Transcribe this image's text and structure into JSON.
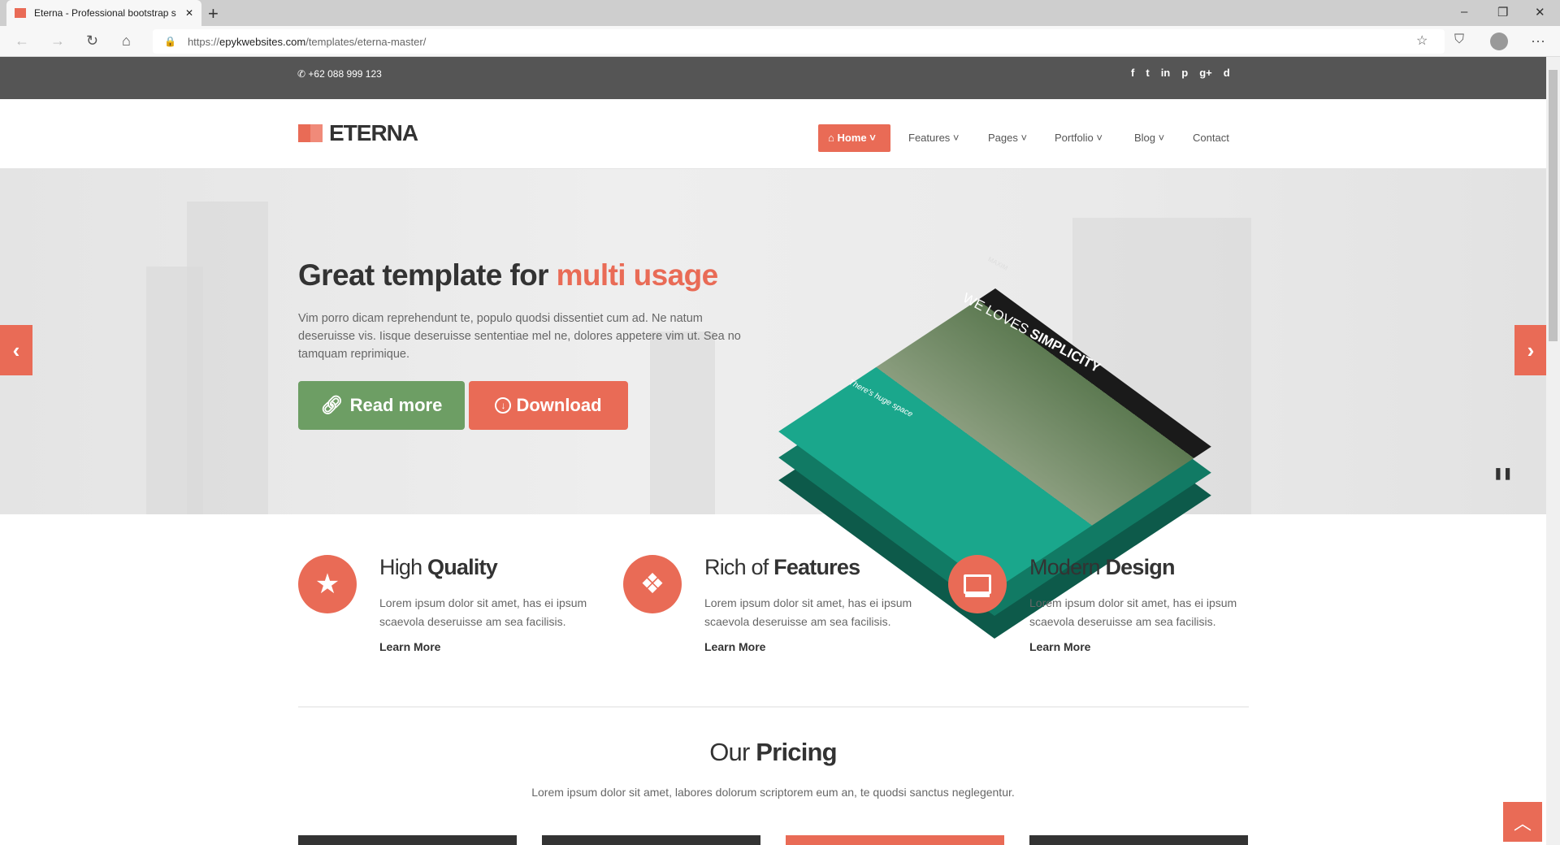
{
  "browser": {
    "tab_title": "Eterna - Professional bootstrap s",
    "url_prefix": "https://",
    "url_domain": "epykwebsites.com",
    "url_path": "/templates/eterna-master/"
  },
  "topbar": {
    "phone": "+62 088 999 123",
    "social": [
      "f",
      "t",
      "in",
      "p",
      "g+",
      "d"
    ]
  },
  "header": {
    "logo": "ETERNA",
    "nav": [
      {
        "label": "Home",
        "active": true
      },
      {
        "label": "Features"
      },
      {
        "label": "Pages"
      },
      {
        "label": "Portfolio"
      },
      {
        "label": "Blog"
      },
      {
        "label": "Contact"
      }
    ]
  },
  "hero": {
    "title_main": "Great template for ",
    "title_accent": "multi usage",
    "text": "Vim porro dicam reprehendunt te, populo quodsi dissentiet cum ad. Ne natum deseruisse vis. Iisque deseruisse sententiae mel ne, dolores appetere vim ut. Sea no tamquam reprimique.",
    "read_more": "Read more",
    "download": "Download",
    "mockup": {
      "brand": "MAXIM",
      "tagline_light": "WE LOVES ",
      "tagline_bold": "SIMPLICITY",
      "quote": "There's huge space"
    }
  },
  "features": [
    {
      "icon": "star-icon",
      "light": "High ",
      "bold": "Quality",
      "text": "Lorem ipsum dolor sit amet, has ei ipsum scaevola deseruisse am sea facilisis.",
      "link": "Learn More"
    },
    {
      "icon": "dropbox-icon",
      "light": "Rich of ",
      "bold": "Features",
      "text": "Lorem ipsum dolor sit amet, has ei ipsum scaevola deseruisse am sea facilisis.",
      "link": "Learn More"
    },
    {
      "icon": "laptop-icon",
      "light": "Modern ",
      "bold": "Design",
      "text": "Lorem ipsum dolor sit amet, has ei ipsum scaevola deseruisse am sea facilisis.",
      "link": "Learn More"
    }
  ],
  "pricing": {
    "light": "Our ",
    "bold": "Pricing",
    "text": "Lorem ipsum dolor sit amet, labores dolorum scriptorem eum an, te quodsi sanctus neglegentur."
  },
  "colors": {
    "accent": "#e96b56",
    "green": "#6d9e64",
    "topbar": "#555555",
    "teal": "#1aa78c"
  }
}
